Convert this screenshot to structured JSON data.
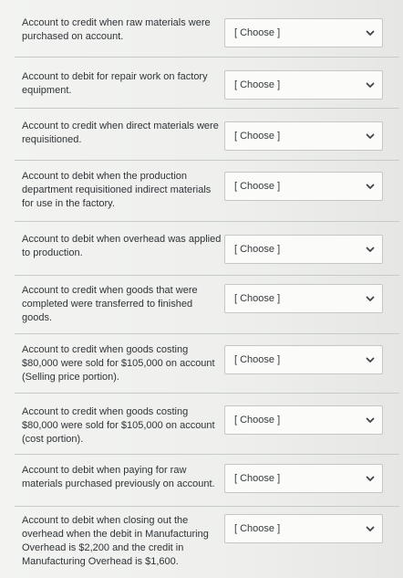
{
  "rows": [
    {
      "question": "Account to credit when raw materials were purchased on account.",
      "selected": "[ Choose ]"
    },
    {
      "question": "Account to debit for repair work on factory equipment.",
      "selected": "[ Choose ]"
    },
    {
      "question": "Account to credit when direct materials were requisitioned.",
      "selected": "[ Choose ]"
    },
    {
      "question": "Account to debit when the production department requisitioned indirect materials for use in the factory.",
      "selected": "[ Choose ]"
    },
    {
      "question": "Account to debit when overhead was applied to production.",
      "selected": "[ Choose ]"
    },
    {
      "question": "Account to credit when goods that were completed were transferred to finished goods.",
      "selected": "[ Choose ]"
    },
    {
      "question": "Account to credit when goods costing $80,000 were sold for $105,000 on account (Selling price portion).",
      "selected": "[ Choose ]"
    },
    {
      "question": "Account to credit when goods costing $80,000 were sold for $105,000 on account (cost portion).",
      "selected": "[ Choose ]"
    },
    {
      "question": "Account to debit when paying for raw materials purchased previously on account.",
      "selected": "[ Choose ]"
    },
    {
      "question": "Account to debit when closing out the overhead when the debit in Manufacturing Overhead is $2,200 and the credit in Manufacturing Overhead is $1,600.",
      "selected": "[ Choose ]"
    }
  ]
}
